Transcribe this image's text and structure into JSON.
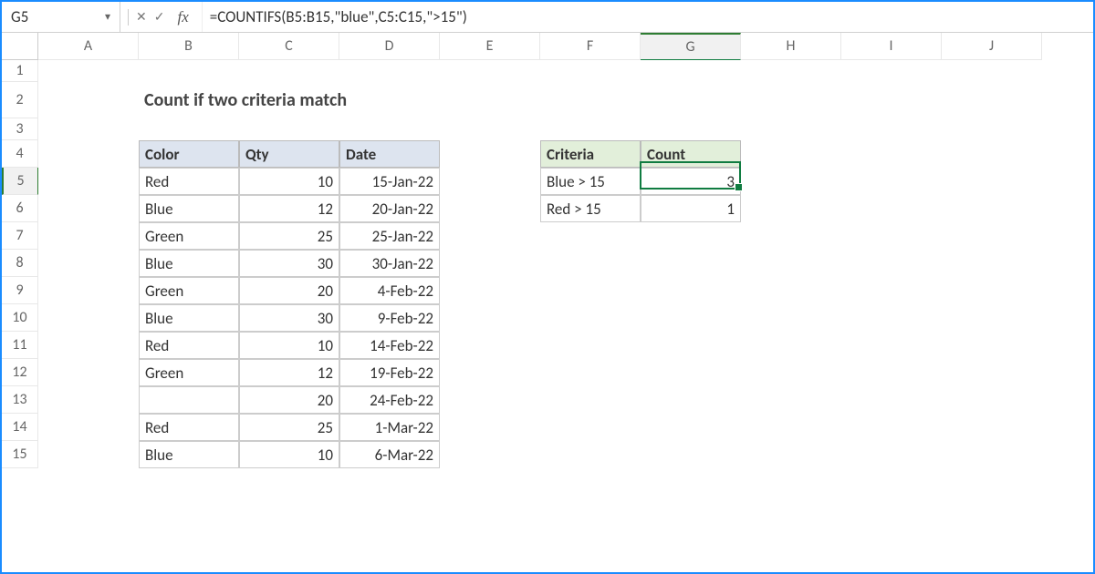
{
  "formula_bar": {
    "cell_ref": "G5",
    "formula": "=COUNTIFS(B5:B15,\"blue\",C5:C15,\">15\")"
  },
  "columns": [
    "A",
    "B",
    "C",
    "D",
    "E",
    "F",
    "G",
    "H",
    "I",
    "J"
  ],
  "rows": [
    "1",
    "2",
    "3",
    "4",
    "5",
    "6",
    "7",
    "8",
    "9",
    "10",
    "11",
    "12",
    "13",
    "14",
    "15"
  ],
  "title": "Count if two criteria match",
  "table1": {
    "headers": {
      "color": "Color",
      "qty": "Qty",
      "date": "Date"
    },
    "rows": [
      {
        "color": "Red",
        "qty": "10",
        "date": "15-Jan-22"
      },
      {
        "color": "Blue",
        "qty": "12",
        "date": "20-Jan-22"
      },
      {
        "color": "Green",
        "qty": "25",
        "date": "25-Jan-22"
      },
      {
        "color": "Blue",
        "qty": "30",
        "date": "30-Jan-22"
      },
      {
        "color": "Green",
        "qty": "20",
        "date": "4-Feb-22"
      },
      {
        "color": "Blue",
        "qty": "30",
        "date": "9-Feb-22"
      },
      {
        "color": "Red",
        "qty": "10",
        "date": "14-Feb-22"
      },
      {
        "color": "Green",
        "qty": "12",
        "date": "19-Feb-22"
      },
      {
        "color": "",
        "qty": "20",
        "date": "24-Feb-22"
      },
      {
        "color": "Red",
        "qty": "25",
        "date": "1-Mar-22"
      },
      {
        "color": "Blue",
        "qty": "10",
        "date": "6-Mar-22"
      }
    ]
  },
  "table2": {
    "headers": {
      "criteria": "Criteria",
      "count": "Count"
    },
    "rows": [
      {
        "criteria": "Blue > 15",
        "count": "3"
      },
      {
        "criteria": "Red > 15",
        "count": "1"
      }
    ]
  },
  "selected": {
    "col": "G",
    "row": "5"
  }
}
